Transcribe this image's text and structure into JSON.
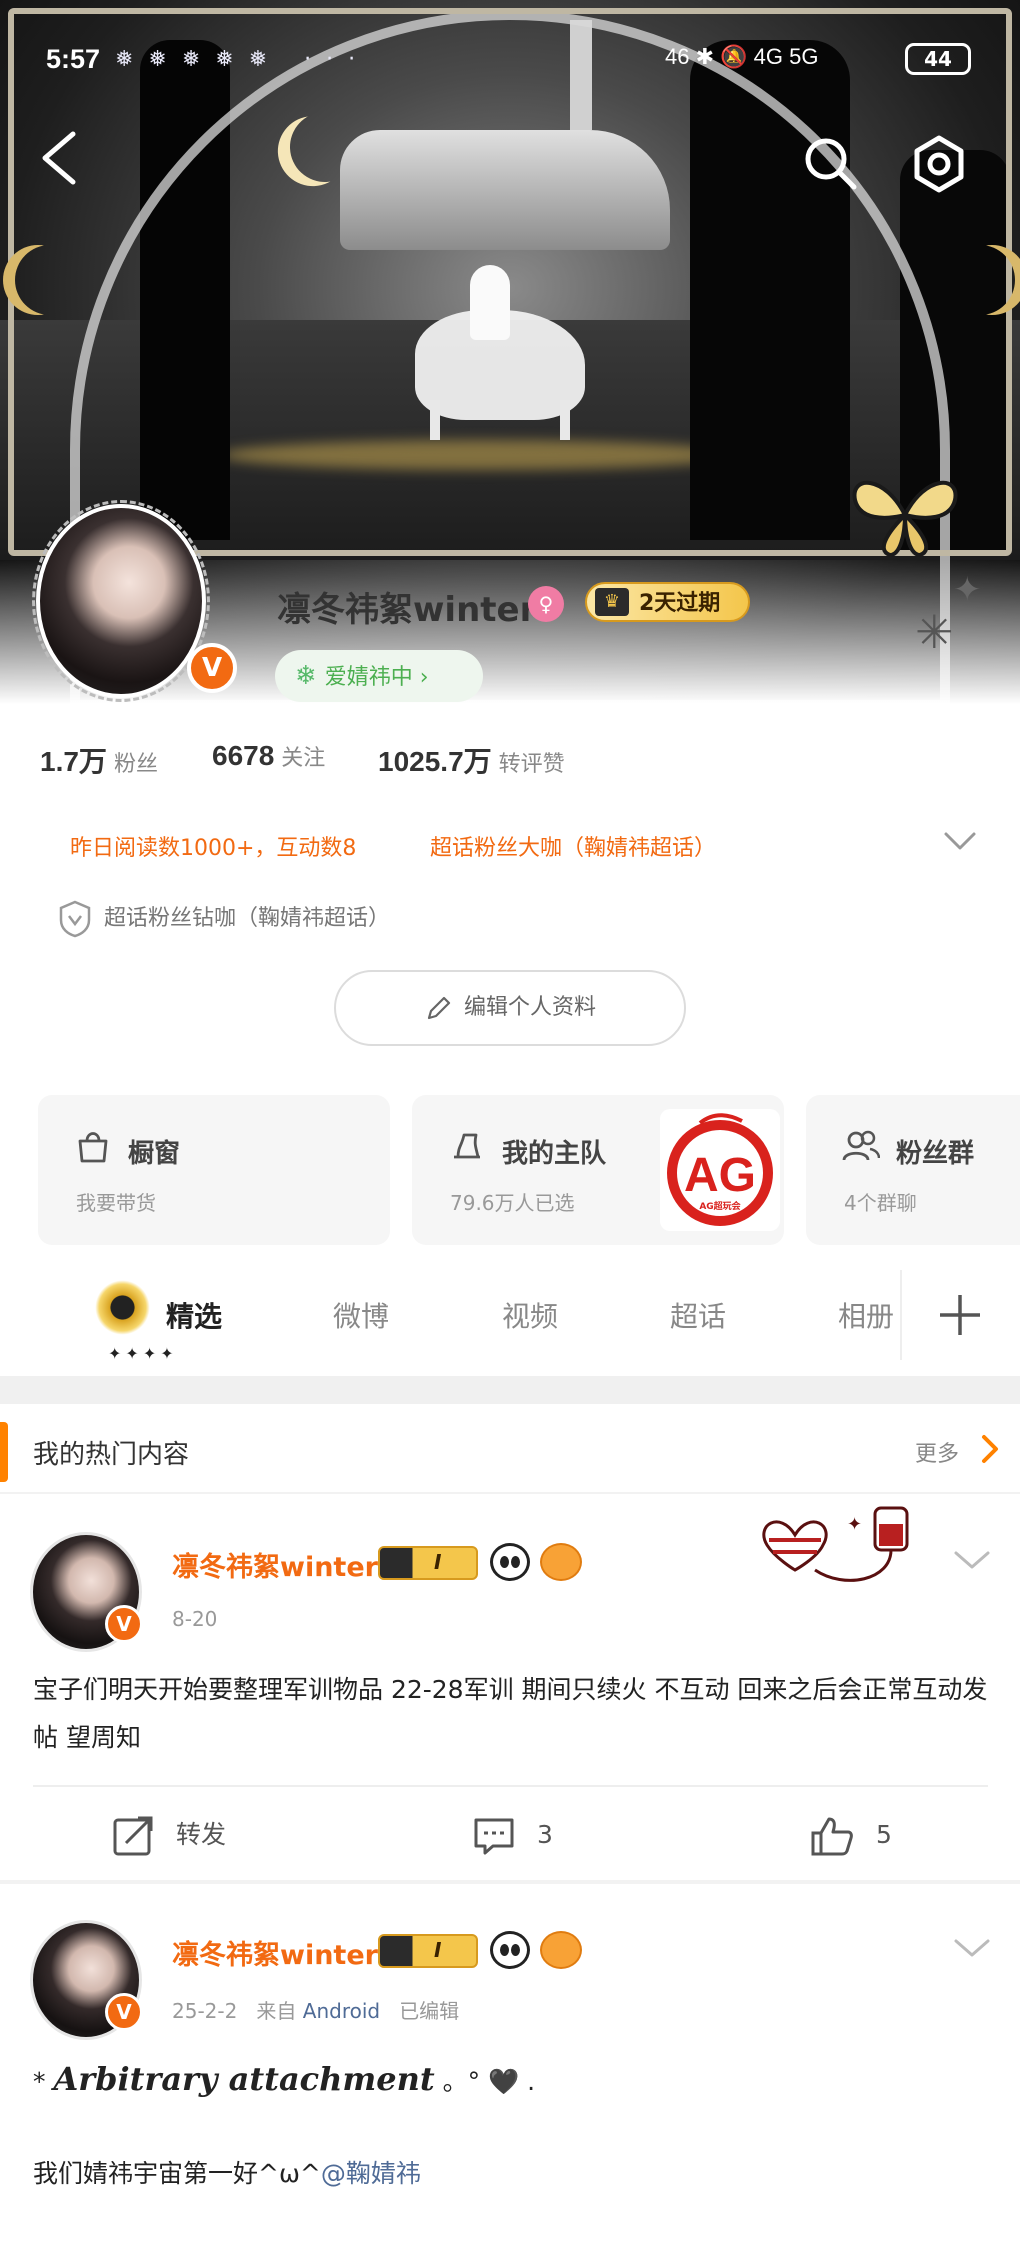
{
  "status_bar": {
    "time": "5:57",
    "notification_dots": "❅❅❅❅❅ ···",
    "network": "46 ✱ 🔕 4G 5G",
    "battery": "44"
  },
  "nav": {
    "back_icon": "chevron-left-icon",
    "search_icon": "search-icon",
    "settings_icon": "gear-icon"
  },
  "profile": {
    "username": "凛冬祎絮winter",
    "verified_badge": "V",
    "gender_icon": "female-icon",
    "vip_label": "2天过期",
    "fan_tag": "爱婧祎中",
    "stats": [
      {
        "value": "1.7万",
        "label": "粉丝"
      },
      {
        "value": "6678",
        "label": "关注"
      },
      {
        "value": "1025.7万",
        "label": "转评赞"
      }
    ],
    "honors": {
      "daily": "昨日阅读数1000+，互动数8",
      "super_fan": "超话粉丝大咖（鞠婧祎超话）",
      "diamond": "超话粉丝钻咖（鞠婧祎超话）"
    },
    "edit_button": "编辑个人资料"
  },
  "cards": [
    {
      "title": "橱窗",
      "subtitle": "我要带货",
      "icon": "shopping-bag-icon"
    },
    {
      "title": "我的主队",
      "subtitle": "79.6万人已选",
      "icon": "cup-icon",
      "logo_text": "AG",
      "logo_caption": "AG超玩会"
    },
    {
      "title": "粉丝群",
      "subtitle": "4个群聊",
      "icon": "group-icon"
    }
  ],
  "tabs": [
    {
      "label": "精选",
      "active": true
    },
    {
      "label": "微博",
      "active": false
    },
    {
      "label": "视频",
      "active": false
    },
    {
      "label": "超话",
      "active": false
    },
    {
      "label": "相册",
      "active": false
    }
  ],
  "tab_decoration": "✦✦✦✦",
  "hot_section": {
    "title": "我的热门内容",
    "more": "更多"
  },
  "posts": [
    {
      "author": "凛冬祎絮winter",
      "level": "I",
      "date": "8-20",
      "text": "宝子们明天开始要整理军训物品 22-28军训 期间只续火 不互动 回来之后会正常互动发帖 望周知",
      "repost_label": "转发",
      "comments": "3",
      "likes": "5"
    },
    {
      "author": "凛冬祎絮winter",
      "level": "I",
      "date": "25-2-2",
      "source_prefix": "来自",
      "source": "Android",
      "edited": "已编辑",
      "line1_prefix": "* ",
      "line1_italic": "Arbitrary attachment",
      "line1_suffix": " 。° 🖤 .",
      "line2": "我们婧祎宇宙第一好^ω^",
      "mention": "@鞠婧祎"
    }
  ],
  "colors": {
    "accent": "#f26a12",
    "link": "#4f6b96",
    "hot_bar": "#ff8200",
    "green": "#4caf50"
  }
}
